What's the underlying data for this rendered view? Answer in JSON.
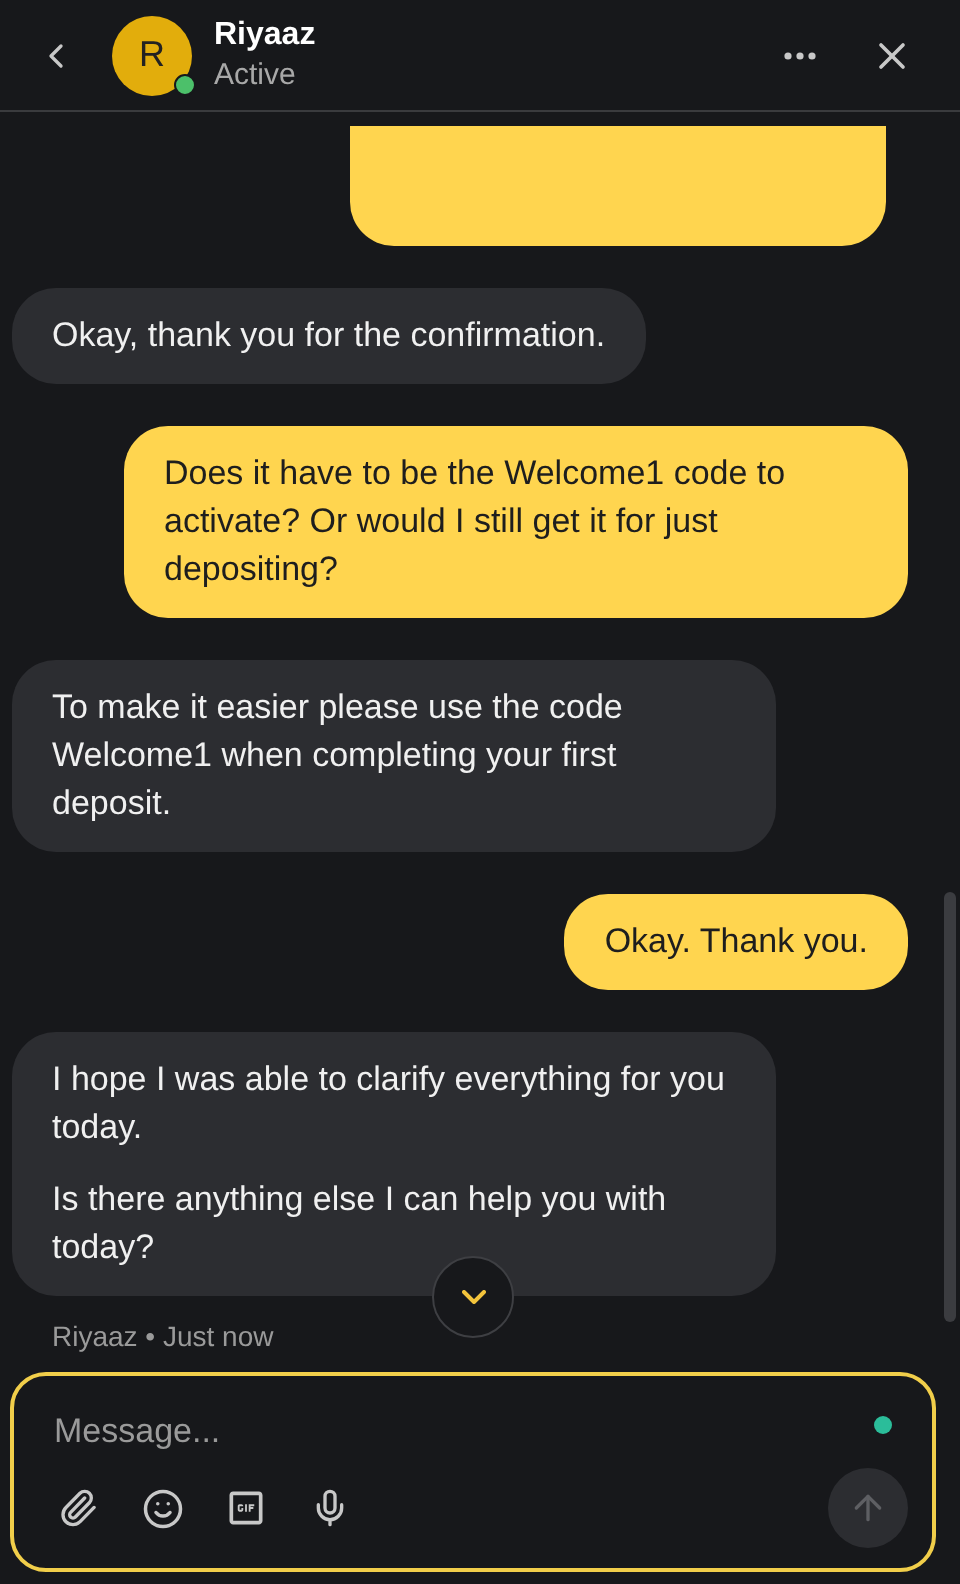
{
  "header": {
    "avatar_initial": "R",
    "name": "Riyaaz",
    "status": "Active",
    "online": true
  },
  "messages": [
    {
      "kind": "clipped"
    },
    {
      "kind": "agent",
      "paragraphs": [
        "Okay, thank you for the confirmation."
      ]
    },
    {
      "kind": "user",
      "paragraphs": [
        "Does it have to be the Welcome1 code to activate? Or would I still get it for just depositing?"
      ]
    },
    {
      "kind": "agent",
      "paragraphs": [
        "To make it easier please use the code Welcome1 when completing your first deposit."
      ]
    },
    {
      "kind": "user",
      "paragraphs": [
        "Okay. Thank you."
      ]
    },
    {
      "kind": "agent",
      "paragraphs": [
        "I hope I was able to clarify everything for you today.",
        "Is there anything else I can help you with today?"
      ]
    }
  ],
  "meta": "Riyaaz • Just now",
  "composer": {
    "placeholder": "Message..."
  }
}
